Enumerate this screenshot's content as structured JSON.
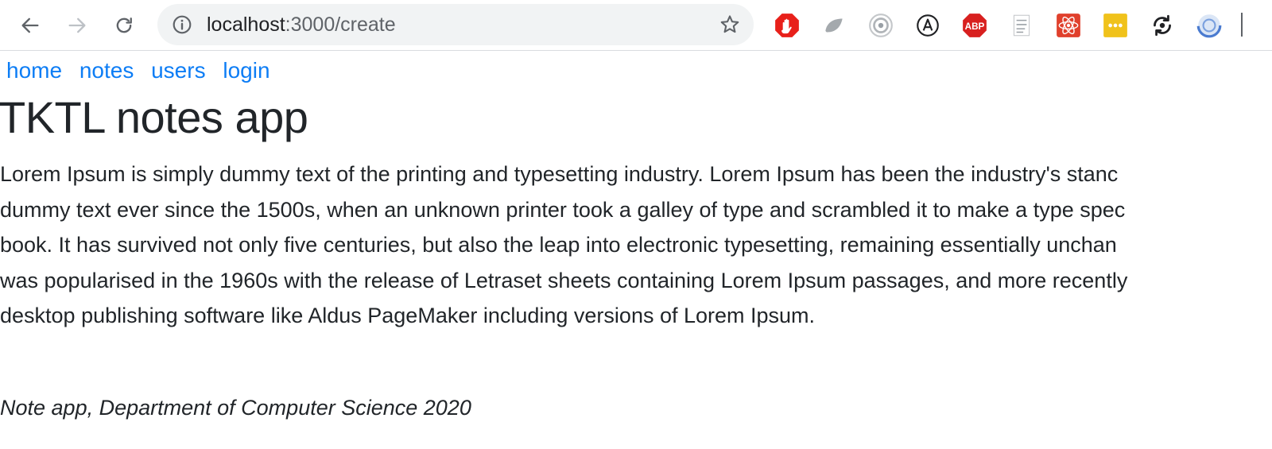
{
  "browser": {
    "url_host": "localhost",
    "url_path": ":3000/create",
    "extensions": [
      {
        "name": "adblock-hand-icon",
        "color": "#e8201a"
      },
      {
        "name": "leaf-extension-icon",
        "color": "#9aa0a6"
      },
      {
        "name": "target-extension-icon",
        "color": "#9aa0a6"
      },
      {
        "name": "circle-a-extension-icon",
        "color": "#202124"
      },
      {
        "name": "abp-extension-icon",
        "color": "#d8201f",
        "text": "ABP"
      },
      {
        "name": "checklist-extension-icon",
        "color": "#9aa0a6"
      },
      {
        "name": "react-devtools-icon",
        "color": "#e0402c"
      },
      {
        "name": "password-manager-icon",
        "color": "#f0c21b"
      },
      {
        "name": "sync-extension-icon",
        "color": "#202124"
      },
      {
        "name": "blue-circle-extension-icon",
        "color": "#4a7bd0"
      }
    ]
  },
  "nav": {
    "links": [
      "home",
      "notes",
      "users",
      "login"
    ]
  },
  "main": {
    "title": "TKTL notes app",
    "lorem_lines": [
      "Lorem Ipsum is simply dummy text of the printing and typesetting industry. Lorem Ipsum has been the industry's stanc",
      "dummy text ever since the 1500s, when an unknown printer took a galley of type and scrambled it to make a type spec",
      "book. It has survived not only five centuries, but also the leap into electronic typesetting, remaining essentially unchan",
      "was popularised in the 1960s with the release of Letraset sheets containing Lorem Ipsum passages, and more recently",
      "desktop publishing software like Aldus PageMaker including versions of Lorem Ipsum."
    ]
  },
  "footer": {
    "text": "Note app, Department of Computer Science 2020"
  },
  "colors": {
    "link": "#0d7df5",
    "text": "#212529"
  }
}
